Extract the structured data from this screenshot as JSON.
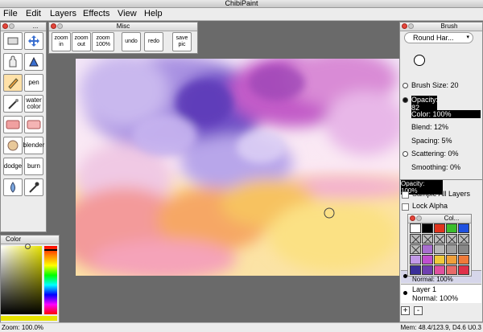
{
  "window": {
    "title": "ChibiPaint"
  },
  "menu": [
    "File",
    "Edit",
    "Layers",
    "Effects",
    "View",
    "Help"
  ],
  "tools_panel": {
    "title": "..."
  },
  "tools": {
    "pen": "pen",
    "water_color": "water color",
    "blender": "blender",
    "dodge": "dodge",
    "burn": "burn"
  },
  "misc_panel": {
    "title": "Misc",
    "buttons": [
      "zoom in",
      "zoom out",
      "zoom 100%",
      "undo",
      "redo",
      "save pic"
    ]
  },
  "brush_panel": {
    "title": "Brush",
    "dropdown_value": "Round Har...",
    "brush_size_label": "Brush Size: 20",
    "opacity_label": "Opacity: 82",
    "color_label": "Color: 100%",
    "blend_label": "Blend: 12%",
    "spacing_label": "Spacing: 5%",
    "scattering_label": "Scattering: 0%",
    "smoothing_label": "Smoothing: 0%",
    "brush_size_active": false,
    "opacity_active": true,
    "scattering_active": false
  },
  "layers_panel": {
    "opacity_label": "Opacity: 100%",
    "sample_all_layers": "Sample All Layers",
    "lock_alpha": "Lock Alpha",
    "layer_top_mode": "Normal: 100%",
    "layer_name": "Layer 1",
    "layer_mode": "Normal: 100%",
    "add_button": "+",
    "remove_button": "-"
  },
  "swatches_panel": {
    "title": "Col...",
    "rows": [
      [
        "#ffffff",
        "#000000",
        "#e0331c",
        "#3bbd2b",
        "#1e50e0"
      ],
      [
        "x",
        "x",
        "x",
        "x",
        "x"
      ],
      [
        "x",
        "#a96fd0",
        "#b8b8b8",
        "#a0a0a0",
        "#888888"
      ],
      [
        "#c29ae8",
        "#c04fd0",
        "#f0c93a",
        "#f0a03a",
        "#f07a3a"
      ],
      [
        "#3a2f9a",
        "#7040b0",
        "#e050a0",
        "#e86a6a",
        "#e0304a"
      ]
    ]
  },
  "color_panel": {
    "title": "Color"
  },
  "status": {
    "zoom": "Zoom: 100.0%",
    "mem": "Mem: 48.4/123.9, D4.6 U0.3"
  },
  "colors": {
    "accent": "#ffe1a8",
    "desk": "#6a6a6a",
    "panel": "#ececec"
  }
}
